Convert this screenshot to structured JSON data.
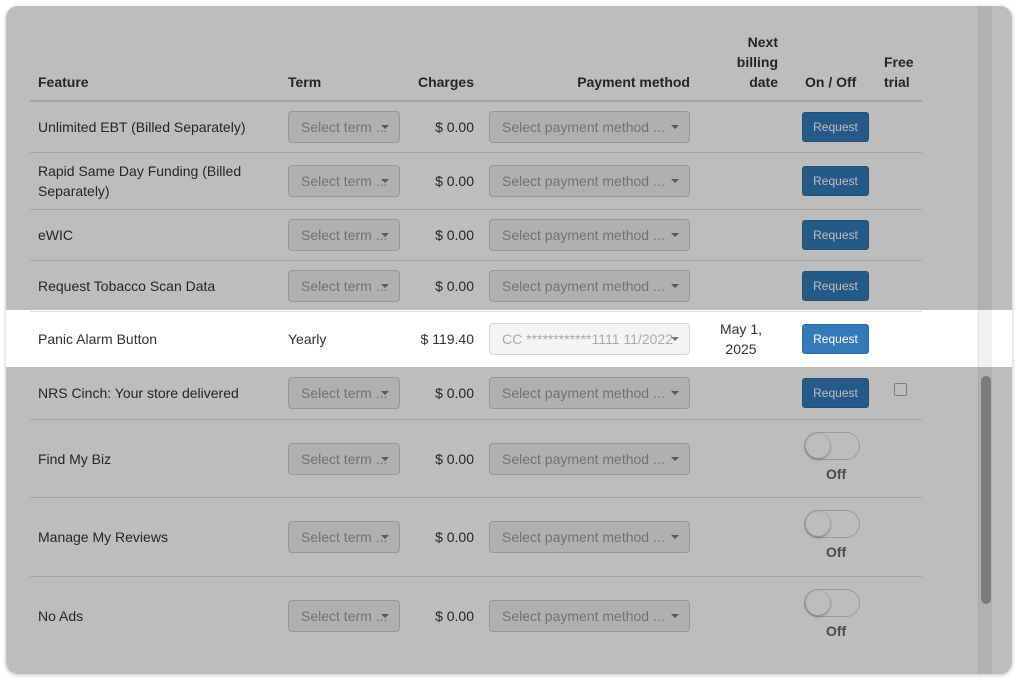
{
  "header": {
    "feature": "Feature",
    "term": "Term",
    "charges": "Charges",
    "payment_method": "Payment method",
    "next_billing_line1": "Next",
    "next_billing_line2": "billing",
    "next_billing_line3": "date",
    "on_off": "On / Off",
    "free_trial_line1": "Free",
    "free_trial_line2": "trial"
  },
  "placeholders": {
    "term": "Select term ...",
    "payment": "Select payment method ..."
  },
  "colors": {
    "primary_button": "#337ab7",
    "overlay": "rgba(0,0,0,0.26)"
  },
  "rows": [
    {
      "feature": "Unlimited EBT (Billed Separately)",
      "charges": "$ 0.00",
      "control": "Request"
    },
    {
      "feature": "Rapid Same Day Funding (Billed Separately)",
      "charges": "$ 0.00",
      "control": "Request"
    },
    {
      "feature": "eWIC",
      "charges": "$ 0.00",
      "control": "Request"
    },
    {
      "feature": "Request Tobacco Scan Data",
      "charges": "$ 0.00",
      "control": "Request"
    },
    {
      "feature": "Panic Alarm Button",
      "term": "Yearly",
      "charges": "$ 119.40",
      "payment": "CC ************1111 11/2022",
      "next_billing_line1": "May 1,",
      "next_billing_line2": "2025",
      "control": "Request"
    },
    {
      "feature": "NRS Cinch: Your store delivered",
      "charges": "$ 0.00",
      "control": "Request",
      "free_trial": false
    },
    {
      "feature": "Find My Biz",
      "charges": "$ 0.00",
      "toggle": "Off"
    },
    {
      "feature": "Manage My Reviews",
      "charges": "$ 0.00",
      "toggle": "Off"
    },
    {
      "feature": "No Ads",
      "charges": "$ 0.00",
      "toggle": "Off"
    }
  ]
}
